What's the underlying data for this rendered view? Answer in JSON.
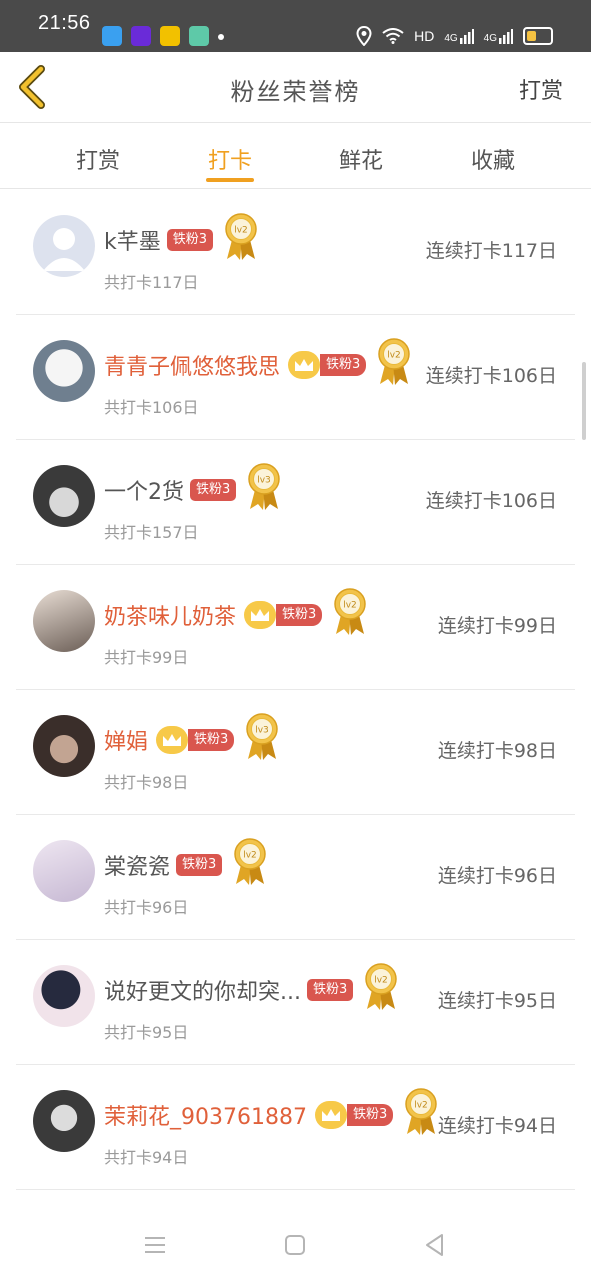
{
  "status": {
    "time": "21:56",
    "network": "HD",
    "signal_1": "4G",
    "signal_2": "4G"
  },
  "header": {
    "title": "粉丝荣誉榜",
    "action_label": "打赏"
  },
  "tabs": [
    {
      "label": "打赏",
      "active": false
    },
    {
      "label": "打卡",
      "active": true
    },
    {
      "label": "鲜花",
      "active": false
    },
    {
      "label": "收藏",
      "active": false
    }
  ],
  "fans": [
    {
      "name": "k芊墨",
      "vip": false,
      "fan_badge": "铁粉3",
      "level": "lv2",
      "total": "共打卡117日",
      "streak": "连续打卡117日"
    },
    {
      "name": "青青子佩悠悠我思",
      "vip": true,
      "fan_badge": "铁粉3",
      "level": "lv2",
      "total": "共打卡106日",
      "streak": "连续打卡106日"
    },
    {
      "name": "一个2货",
      "vip": false,
      "fan_badge": "铁粉3",
      "level": "lv3",
      "total": "共打卡157日",
      "streak": "连续打卡106日"
    },
    {
      "name": "奶茶味儿奶茶",
      "vip": true,
      "fan_badge": "铁粉3",
      "level": "lv2",
      "total": "共打卡99日",
      "streak": "连续打卡99日"
    },
    {
      "name": "婵娟",
      "vip": true,
      "fan_badge": "铁粉3",
      "level": "lv3",
      "total": "共打卡98日",
      "streak": "连续打卡98日"
    },
    {
      "name": "棠瓷瓷",
      "vip": false,
      "fan_badge": "铁粉3",
      "level": "lv2",
      "total": "共打卡96日",
      "streak": "连续打卡96日"
    },
    {
      "name": "说好更文的你却突...",
      "vip": false,
      "fan_badge": "铁粉3",
      "level": "lv2",
      "total": "共打卡95日",
      "streak": "连续打卡95日"
    },
    {
      "name": "茉莉花_903761887",
      "vip": true,
      "fan_badge": "铁粉3",
      "level": "lv2",
      "total": "共打卡94日",
      "streak": "连续打卡94日"
    }
  ],
  "colors": {
    "accent": "#f0a020",
    "vip_name": "#e0603a",
    "fan_badge": "#d9564e",
    "crown": "#f7c948",
    "status_bar": "#4a4a4a"
  }
}
